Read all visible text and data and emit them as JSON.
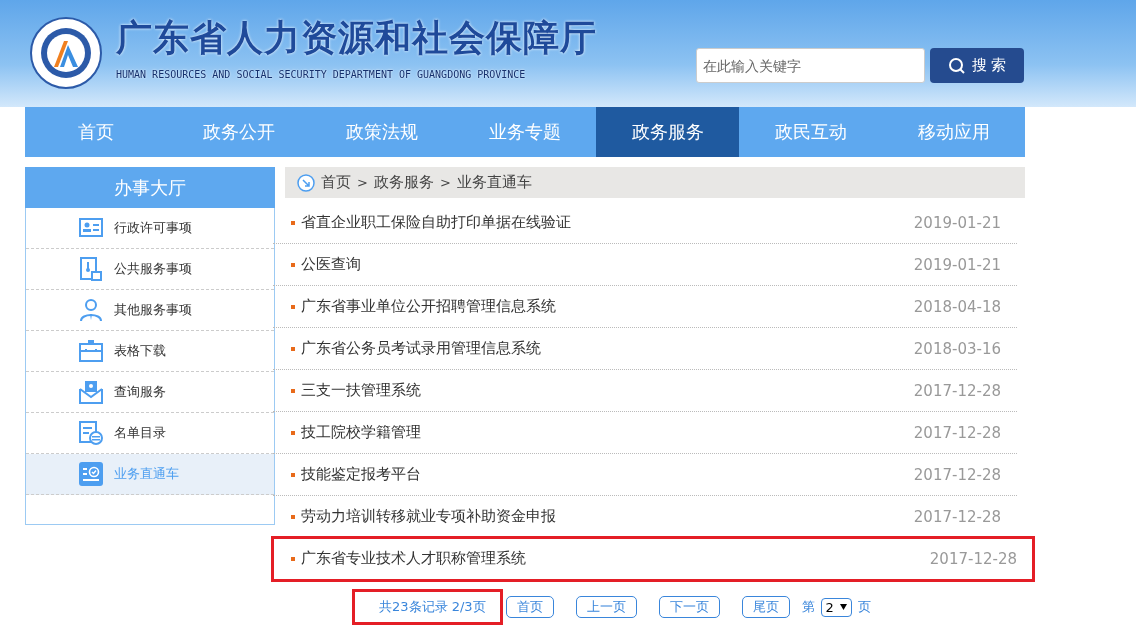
{
  "header": {
    "title": "广东省人力资源和社会保障厅",
    "subtitle": "HUMAN RESOURCES AND SOCIAL SECURITY DEPARTMENT OF GUANGDONG PROVINCE",
    "search": {
      "placeholder": "在此输入关键字",
      "button": "搜 索"
    }
  },
  "nav": [
    {
      "label": "首页",
      "selected": false
    },
    {
      "label": "政务公开",
      "selected": false
    },
    {
      "label": "政策法规",
      "selected": false
    },
    {
      "label": "业务专题",
      "selected": false
    },
    {
      "label": "政务服务",
      "selected": true
    },
    {
      "label": "政民互动",
      "selected": false
    },
    {
      "label": "移动应用",
      "selected": false
    }
  ],
  "sidebar": {
    "title": "办事大厅",
    "items": [
      {
        "label": "行政许可事项",
        "kind": "id-card",
        "selected": false
      },
      {
        "label": "公共服务事项",
        "kind": "document-lock",
        "selected": false
      },
      {
        "label": "其他服务事项",
        "kind": "person",
        "selected": false
      },
      {
        "label": "表格下载",
        "kind": "briefcase",
        "selected": false
      },
      {
        "label": "查询服务",
        "kind": "envelope",
        "selected": false
      },
      {
        "label": "名单目录",
        "kind": "list-doc",
        "selected": false
      },
      {
        "label": "业务直通车",
        "kind": "check-card",
        "selected": true
      }
    ]
  },
  "breadcrumb": [
    "首页",
    ">",
    "政务服务",
    ">",
    "业务直通车"
  ],
  "list": [
    {
      "title": "省直企业职工保险自助打印单据在线验证",
      "date": "2019-01-21",
      "highlighted": false
    },
    {
      "title": "公医查询",
      "date": "2019-01-21",
      "highlighted": false
    },
    {
      "title": "广东省事业单位公开招聘管理信息系统",
      "date": "2018-04-18",
      "highlighted": false
    },
    {
      "title": "广东省公务员考试录用管理信息系统",
      "date": "2018-03-16",
      "highlighted": false
    },
    {
      "title": "三支一扶管理系统",
      "date": "2017-12-28",
      "highlighted": false
    },
    {
      "title": "技工院校学籍管理",
      "date": "2017-12-28",
      "highlighted": false
    },
    {
      "title": "技能鉴定报考平台",
      "date": "2017-12-28",
      "highlighted": false
    },
    {
      "title": "劳动力培训转移就业专项补助资金申报",
      "date": "2017-12-28",
      "highlighted": false
    },
    {
      "title": "广东省专业技术人才职称管理系统",
      "date": "2017-12-28",
      "highlighted": true
    }
  ],
  "pagination": {
    "summary": "共23条记录 2/3页",
    "summary_highlighted": true,
    "buttons": [
      "首页",
      "上一页",
      "下一页",
      "尾页"
    ],
    "page_prefix": "第",
    "page_value": "2",
    "page_suffix": "页"
  }
}
